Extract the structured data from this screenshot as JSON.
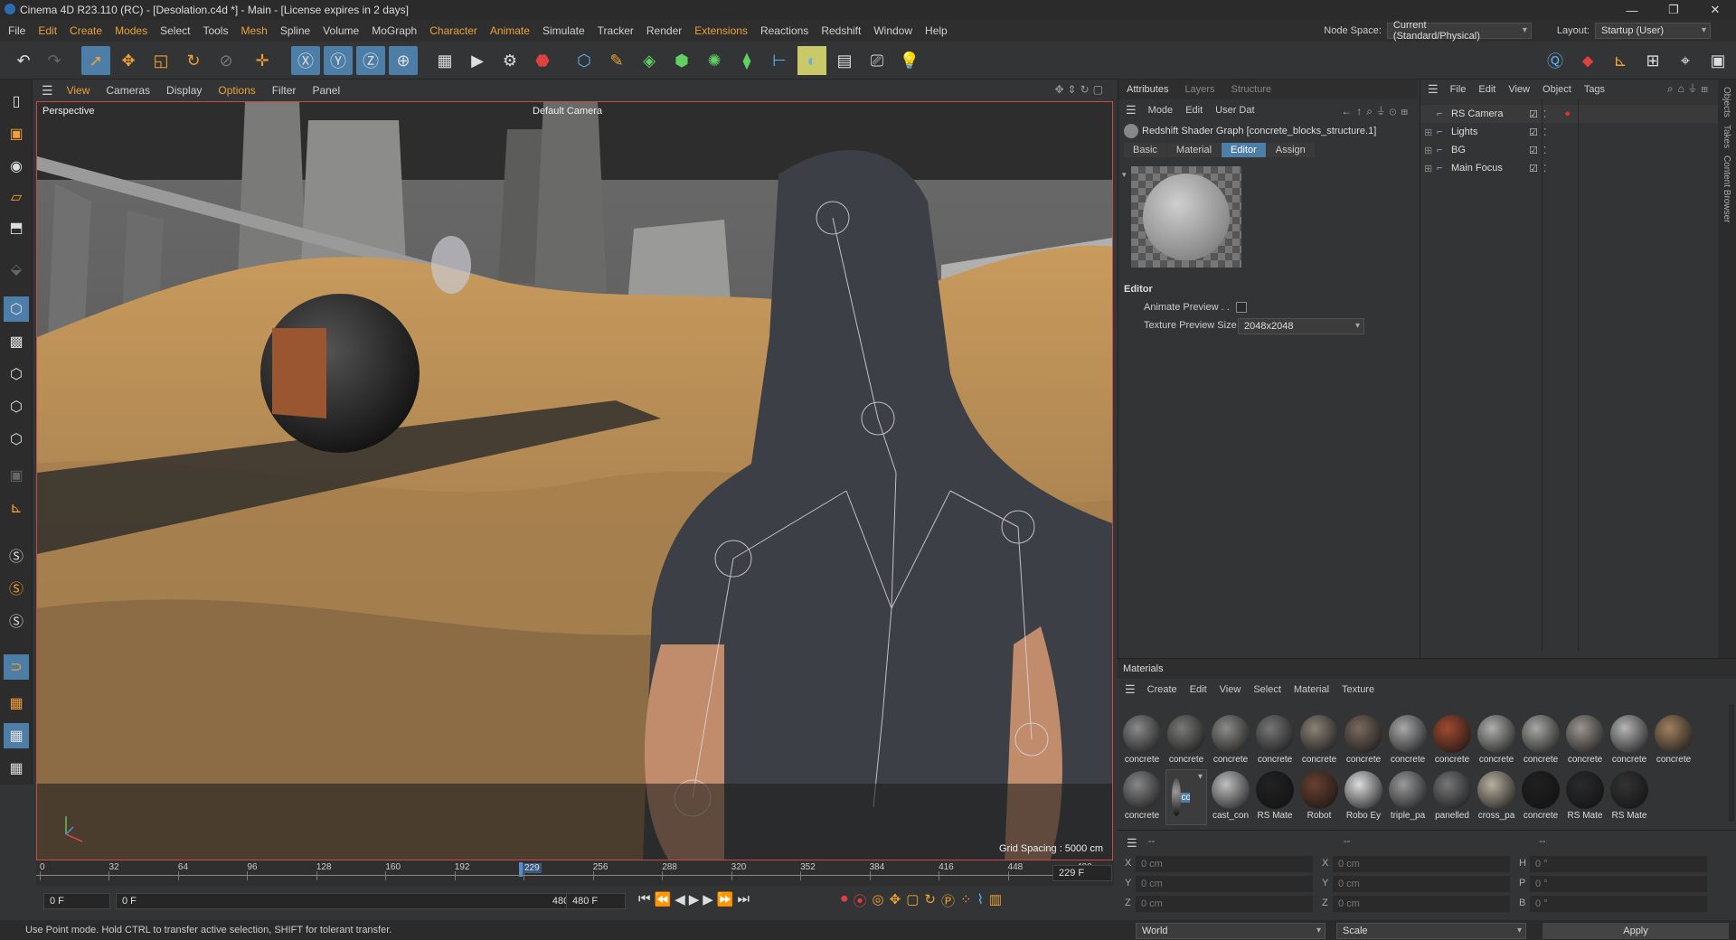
{
  "app": {
    "title": "Cinema 4D R23.110 (RC) - [Desolation.c4d *] - Main - [License expires in 2 days]",
    "win_min": "—",
    "win_max": "❐",
    "win_close": "✕"
  },
  "menu": [
    "File",
    "Edit",
    "Create",
    "Modes",
    "Select",
    "Tools",
    "Mesh",
    "Spline",
    "Volume",
    "MoGraph",
    "Character",
    "Animate",
    "Simulate",
    "Tracker",
    "Render",
    "Extensions",
    "Reactions",
    "Redshift",
    "Window",
    "Help"
  ],
  "menu_highlight": [
    "Edit",
    "Create",
    "Modes",
    "Mesh",
    "Character",
    "Animate",
    "Extensions"
  ],
  "node_space": {
    "label": "Node Space:",
    "value": "Current (Standard/Physical)"
  },
  "layout": {
    "label": "Layout:",
    "value": "Startup (User)"
  },
  "viewport": {
    "menu": [
      "View",
      "Cameras",
      "Display",
      "Options",
      "Filter",
      "Panel"
    ],
    "menu_highlight": [
      "View",
      "Options"
    ],
    "label": "Perspective",
    "camera": "Default Camera",
    "grid_spacing": "Grid Spacing : 5000 cm"
  },
  "timeline": {
    "ticks": [
      "0",
      "32",
      "64",
      "96",
      "128",
      "160",
      "192",
      "224",
      "256",
      "288",
      "320",
      "352",
      "384",
      "416",
      "448",
      "480"
    ],
    "current_marker": "229",
    "current_frame": "229 F"
  },
  "transport": {
    "start": "0 F",
    "min": "0 F",
    "max": "480 F",
    "end": "480 F"
  },
  "status": "Use Point mode. Hold CTRL to transfer active selection, SHIFT for tolerant transfer.",
  "attributes": {
    "tabs": [
      "Attributes",
      "Layers",
      "Structure"
    ],
    "menu": [
      "Mode",
      "Edit",
      "User Dat"
    ],
    "object_name": "Redshift Shader Graph [concrete_blocks_structure.1]",
    "subtabs": [
      "Basic",
      "Material",
      "Editor",
      "Assign"
    ],
    "active_subtab": "Editor",
    "section": "Editor",
    "animate_preview_label": "Animate Preview . .",
    "texture_preview_label": "Texture Preview Size",
    "texture_preview_value": "2048x2048"
  },
  "objects": {
    "menu": [
      "File",
      "Edit",
      "View",
      "Object",
      "Tags"
    ],
    "items": [
      {
        "name": "RS Camera"
      },
      {
        "name": "Lights"
      },
      {
        "name": "BG"
      },
      {
        "name": "Main Focus"
      }
    ],
    "side_tabs": [
      "Objects",
      "Takes",
      "Content Browser"
    ]
  },
  "materials": {
    "title": "Materials",
    "menu": [
      "Create",
      "Edit",
      "View",
      "Select",
      "Material",
      "Texture"
    ],
    "row1": [
      "concrete",
      "concrete",
      "concrete",
      "concrete",
      "concrete",
      "concrete",
      "concrete",
      "concrete",
      "concrete",
      "concrete",
      "concrete",
      "concrete",
      "concrete"
    ],
    "row2": [
      "concrete",
      "concrete",
      "cast_con",
      "RS Mate",
      "Robot",
      "Robo Ey",
      "triple_pa",
      "panelled",
      "cross_pa",
      "concrete",
      "RS Mate",
      "RS Mate"
    ],
    "selected_label": "concrete"
  },
  "coords": {
    "col1": [
      {
        "axis": "X",
        "value": "0 cm"
      },
      {
        "axis": "Y",
        "value": "0 cm"
      },
      {
        "axis": "Z",
        "value": "0 cm"
      }
    ],
    "col2": [
      {
        "axis": "X",
        "value": "0 cm"
      },
      {
        "axis": "Y",
        "value": "0 cm"
      },
      {
        "axis": "Z",
        "value": "0 cm"
      }
    ],
    "col3": [
      {
        "axis": "H",
        "value": "0 °"
      },
      {
        "axis": "P",
        "value": "0 °"
      },
      {
        "axis": "B",
        "value": "0 °"
      }
    ],
    "headers": [
      "--",
      "--",
      "--"
    ],
    "space": "World",
    "mode": "Scale",
    "apply": "Apply"
  }
}
